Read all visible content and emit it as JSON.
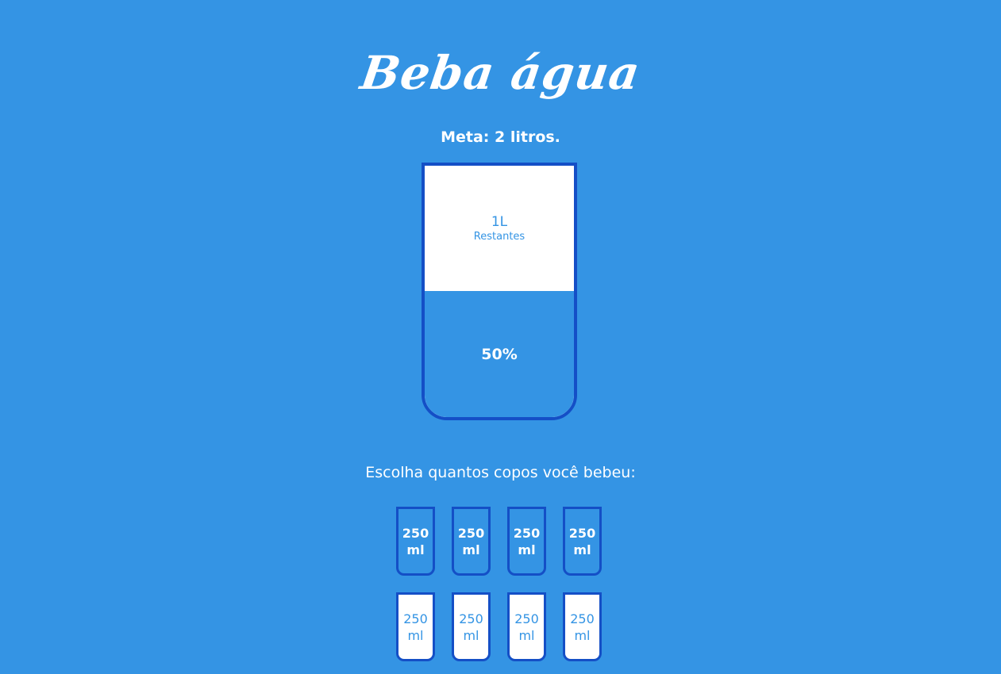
{
  "title": "Beba água",
  "goal": "Meta: 2 litros.",
  "big_cup": {
    "remained_value": "1L",
    "remained_label": "Restantes",
    "percentage_label": "50%",
    "filled_fraction": 0.5
  },
  "prompt": "Escolha quantos copos você bebeu:",
  "cups": [
    {
      "amount": "250",
      "unit": "ml",
      "filled": true
    },
    {
      "amount": "250",
      "unit": "ml",
      "filled": true
    },
    {
      "amount": "250",
      "unit": "ml",
      "filled": true
    },
    {
      "amount": "250",
      "unit": "ml",
      "filled": true
    },
    {
      "amount": "250",
      "unit": "ml",
      "filled": false
    },
    {
      "amount": "250",
      "unit": "ml",
      "filled": false
    },
    {
      "amount": "250",
      "unit": "ml",
      "filled": false
    },
    {
      "amount": "250",
      "unit": "ml",
      "filled": false
    }
  ],
  "colors": {
    "background": "#3494e4",
    "cup_border": "#144fc6",
    "cup_empty": "#ffffff"
  }
}
